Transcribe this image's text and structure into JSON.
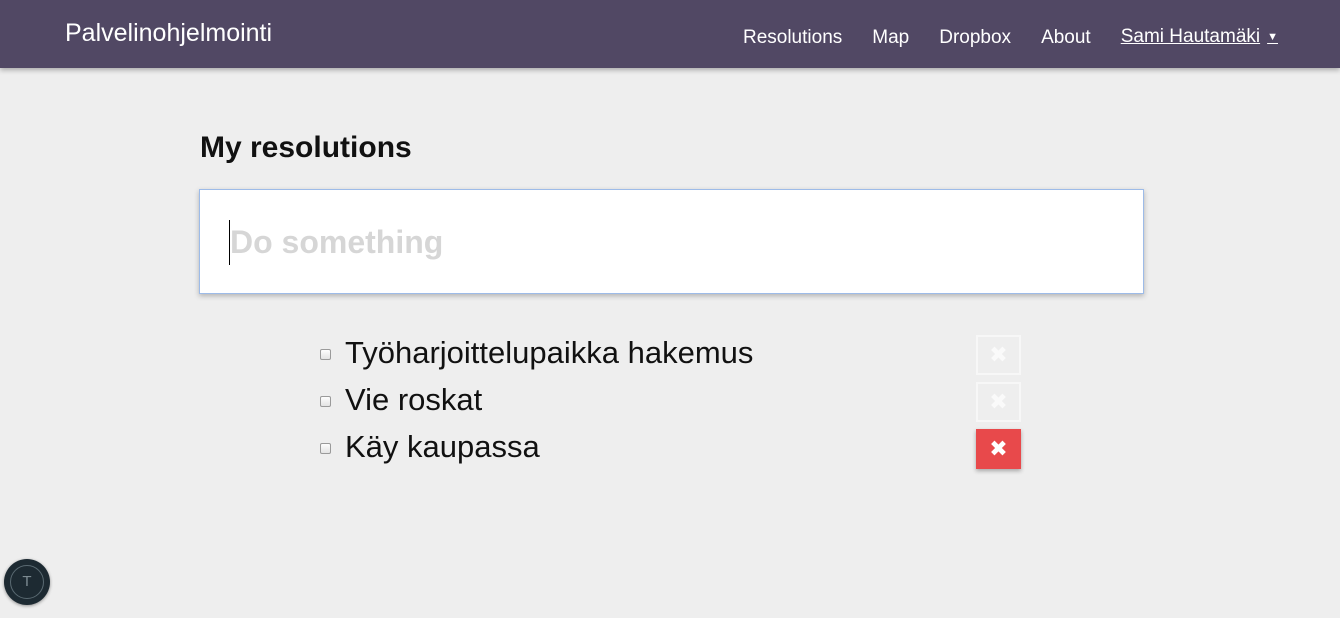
{
  "navbar": {
    "brand": "Palvelinohjelmointi",
    "links": [
      "Resolutions",
      "Map",
      "Dropbox",
      "About"
    ],
    "user": {
      "name": "Sami Hautamäki",
      "caret": "▼"
    }
  },
  "main": {
    "title": "My resolutions",
    "new_task": {
      "placeholder": "Do something",
      "value": ""
    },
    "tasks": [
      {
        "text": "Työharjoittelupaikka hakemus",
        "checked": false,
        "delete_state": "faded"
      },
      {
        "text": "Vie roskat",
        "checked": false,
        "delete_state": "faded"
      },
      {
        "text": "Käy kaupassa",
        "checked": false,
        "delete_state": "active"
      }
    ],
    "delete_glyph": "✖"
  },
  "corner_badge": {
    "letter": "T"
  },
  "colors": {
    "navbar_bg": "#514864",
    "page_bg": "#eeeeee",
    "delete_active": "#e8494b",
    "input_border": "#9dbbe8"
  },
  "icons": {
    "delete": "close-icon",
    "user_menu": "chevron-down-icon"
  }
}
